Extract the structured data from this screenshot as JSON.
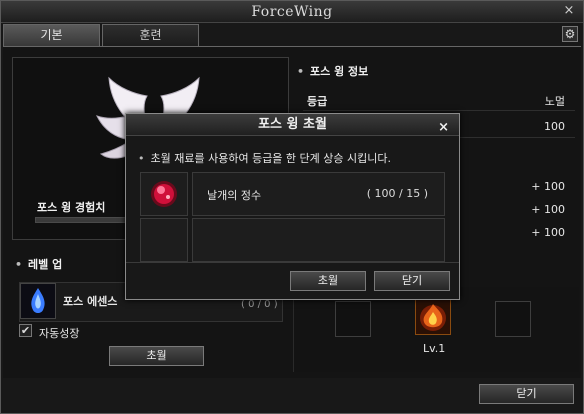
{
  "window": {
    "title": "ForceWing",
    "close_icon": "×"
  },
  "tabs": [
    {
      "label": "기본"
    },
    {
      "label": "훈련"
    }
  ],
  "settings_icon": "⚙",
  "left": {
    "xp_label": "포스 윙 경험치",
    "level_header": "레벨 업",
    "essence_label": "포스 에센스",
    "essence_count": "( 0 / 0 )",
    "auto_grow_label": "자동성장",
    "auto_grow_checked": "✔",
    "upgrade_button": "초월"
  },
  "info": {
    "header": "포스 윙 정보",
    "grade_label": "등급",
    "grade_value": "노멀",
    "row2_value": "100",
    "bonuses": [
      "+ 100",
      "+ 100",
      "+ 100"
    ]
  },
  "slots": {
    "level_label": "Lv.1"
  },
  "footer": {
    "close_button": "닫기"
  },
  "dialog": {
    "title": "포스 윙 초월",
    "close_icon": "×",
    "description": "초월 재료를 사용하여 등급을 한 단계 상승 시킵니다.",
    "material_name": "날개의 정수",
    "material_count": "( 100 / 15 )",
    "ok_button": "초월",
    "close_button": "닫기"
  },
  "colors": {
    "accent_wing": "#f2eef4",
    "essence_blue": "#3a7cff",
    "material_red": "#d0103a",
    "slot_fire": "#e8641a"
  }
}
